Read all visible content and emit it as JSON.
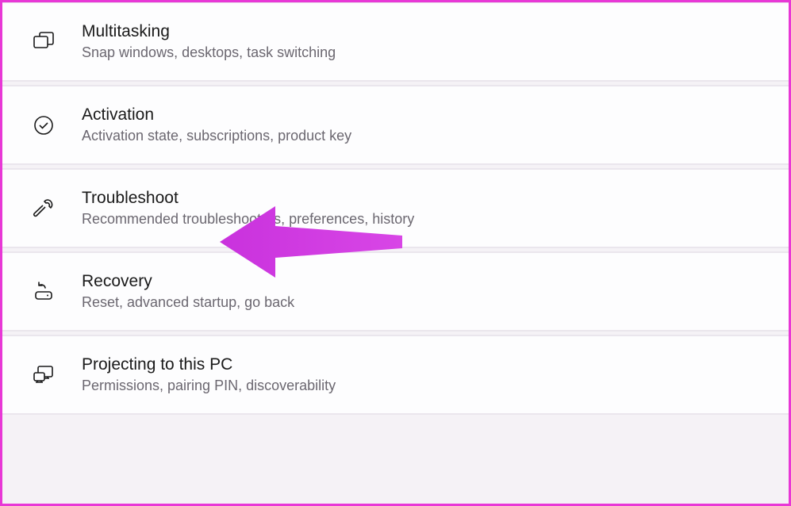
{
  "settings_items": [
    {
      "icon_name": "multitasking-icon",
      "title": "Multitasking",
      "description": "Snap windows, desktops, task switching"
    },
    {
      "icon_name": "activation-icon",
      "title": "Activation",
      "description": "Activation state, subscriptions, product key"
    },
    {
      "icon_name": "troubleshoot-icon",
      "title": "Troubleshoot",
      "description": "Recommended troubleshooters, preferences, history"
    },
    {
      "icon_name": "recovery-icon",
      "title": "Recovery",
      "description": "Reset, advanced startup, go back"
    },
    {
      "icon_name": "projecting-icon",
      "title": "Projecting to this PC",
      "description": "Permissions, pairing PIN, discoverability"
    }
  ]
}
